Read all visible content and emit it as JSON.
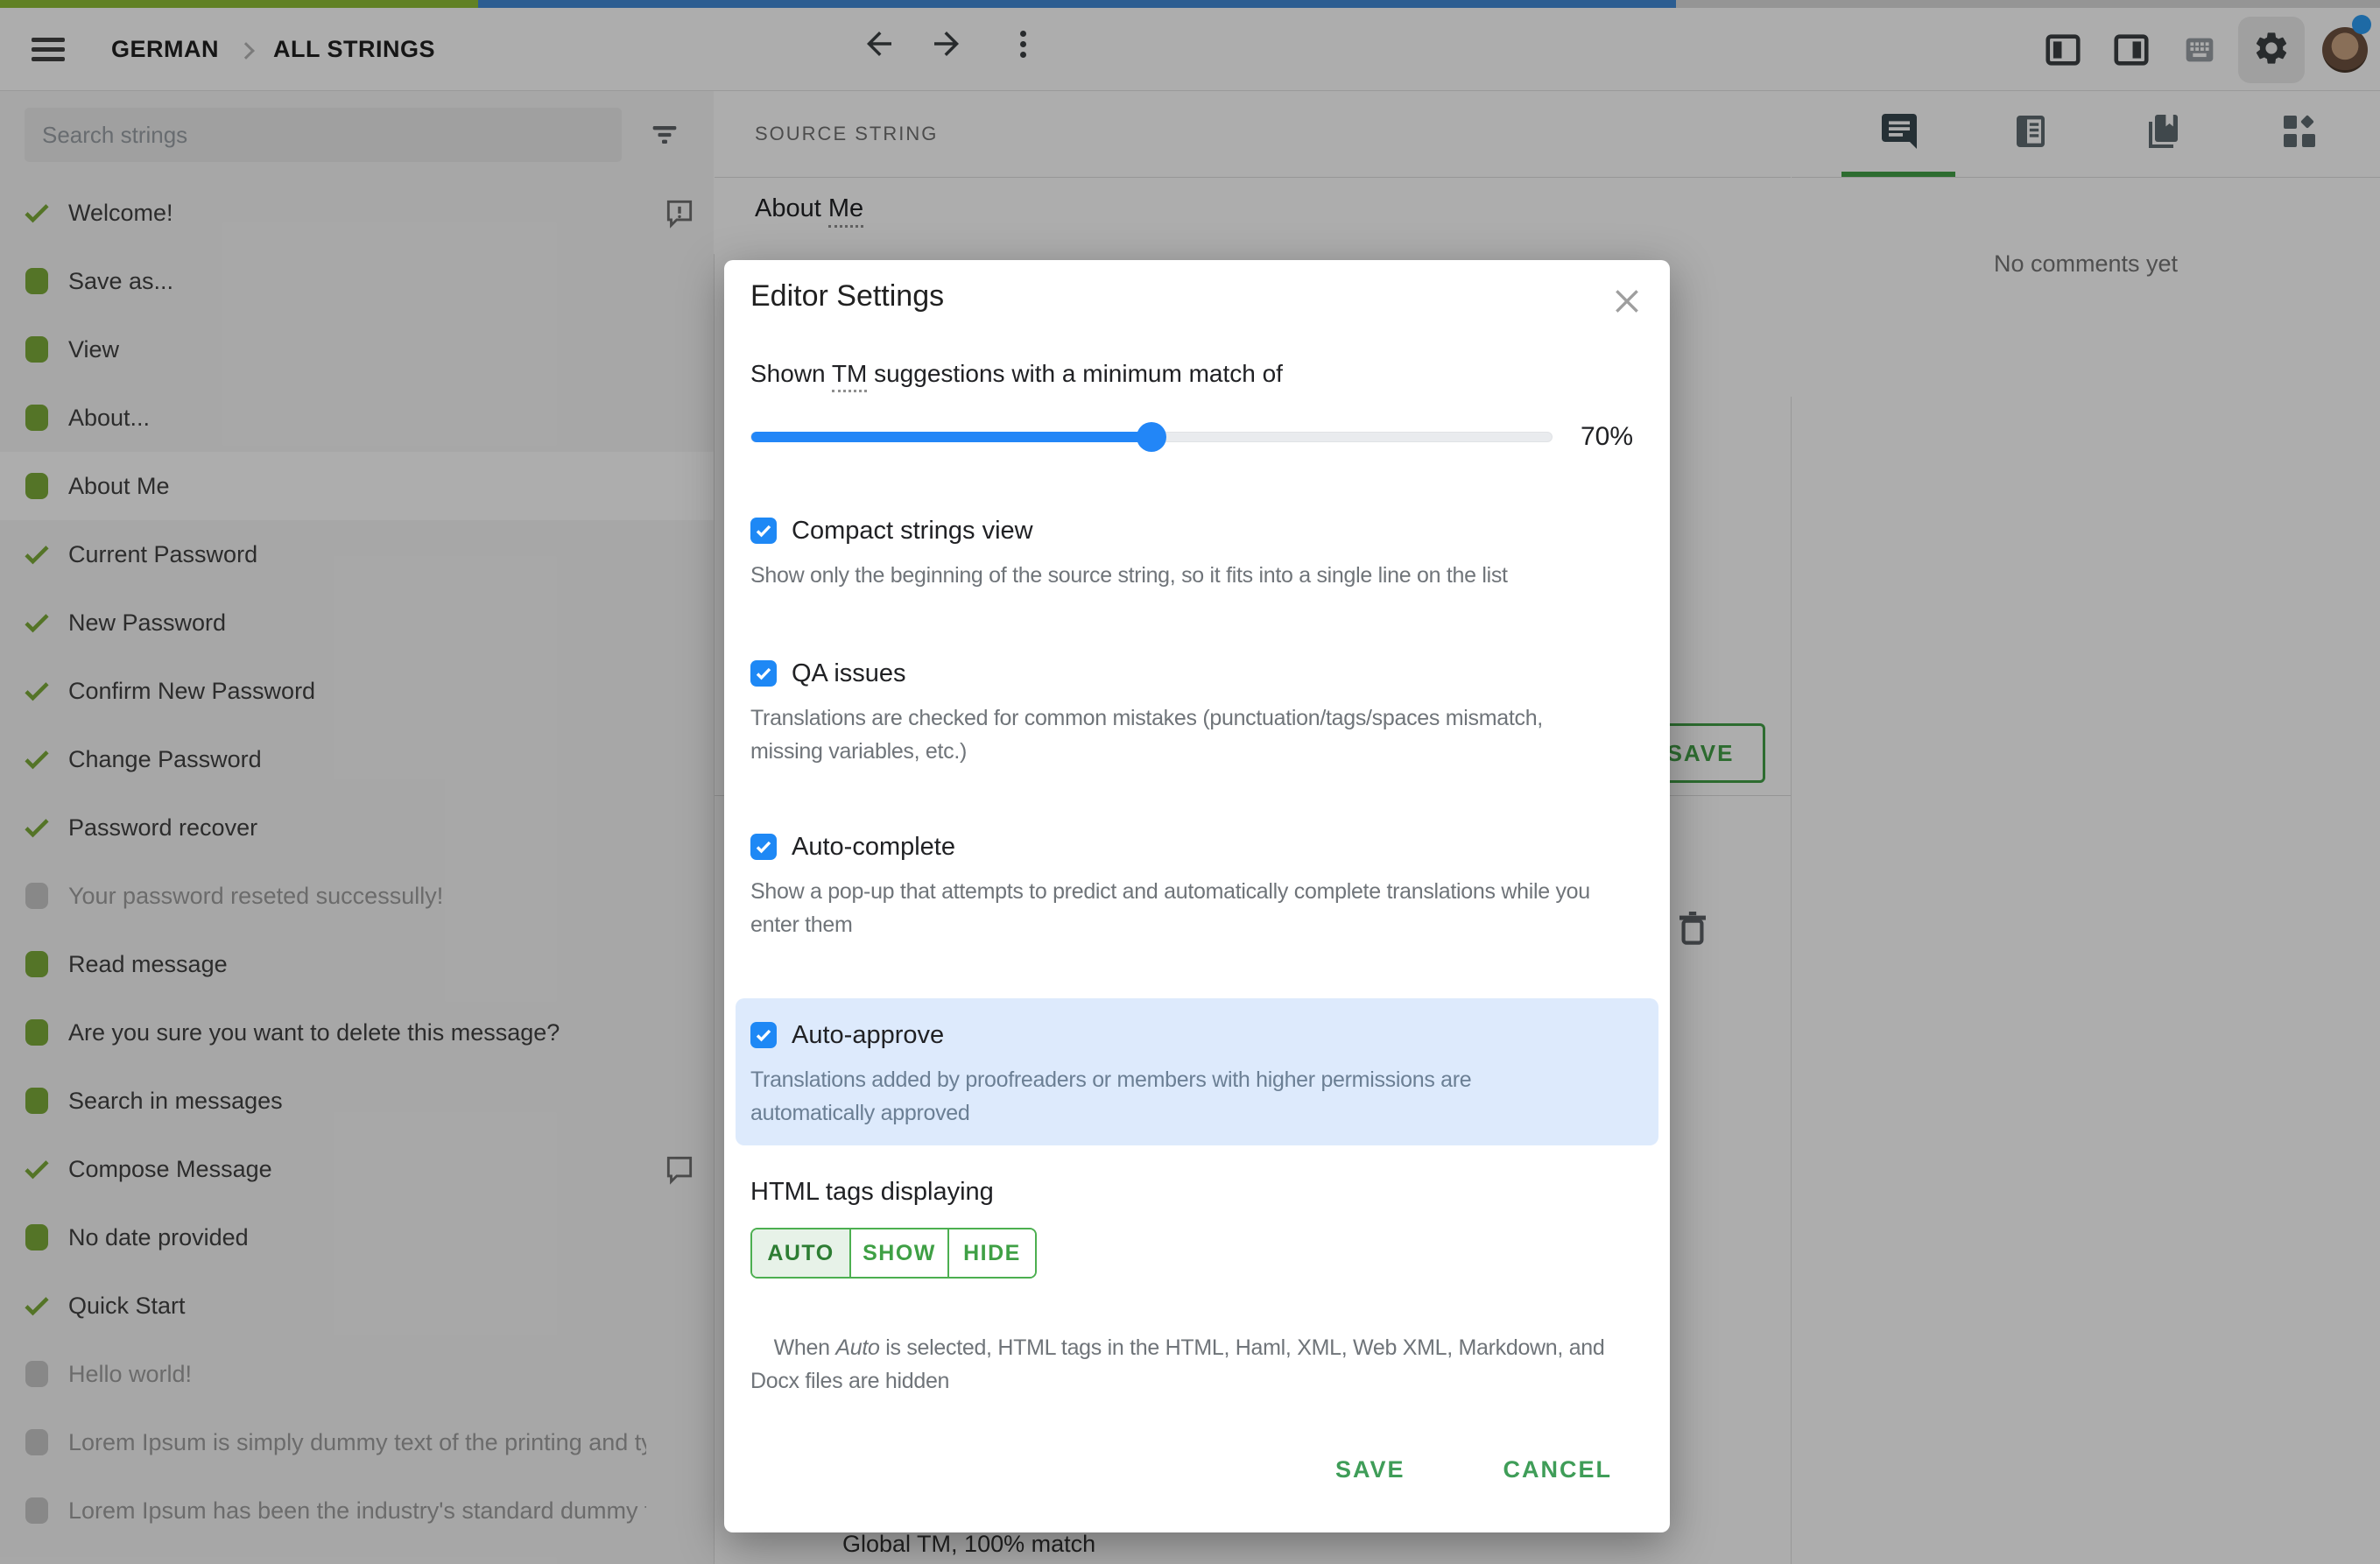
{
  "topbar": {
    "breadcrumb": {
      "project": "GERMAN",
      "section": "ALL STRINGS"
    },
    "progress": {
      "approved_pct": 20,
      "translated_pct": 50,
      "approved_color": "#8fbf35",
      "translated_color": "#4189d6"
    }
  },
  "sidebar": {
    "search_placeholder": "Search strings",
    "items": [
      {
        "label": "Welcome!",
        "status": "approved",
        "comment": "exclamation"
      },
      {
        "label": "Save as...",
        "status": "translated"
      },
      {
        "label": "View",
        "status": "translated"
      },
      {
        "label": "About...",
        "status": "translated"
      },
      {
        "label": "About Me",
        "status": "translated",
        "selected": true
      },
      {
        "label": "Current Password",
        "status": "approved"
      },
      {
        "label": "New Password",
        "status": "approved"
      },
      {
        "label": "Confirm New Password",
        "status": "approved"
      },
      {
        "label": "Change Password",
        "status": "approved"
      },
      {
        "label": "Password recover",
        "status": "approved"
      },
      {
        "label": "Your password reseted successully!",
        "status": "untranslated"
      },
      {
        "label": "Read message",
        "status": "translated"
      },
      {
        "label": "Are you sure you want to delete this message?",
        "status": "translated"
      },
      {
        "label": "Search in messages",
        "status": "translated"
      },
      {
        "label": "Compose Message",
        "status": "approved",
        "comment": "plain"
      },
      {
        "label": "No date provided",
        "status": "translated"
      },
      {
        "label": "Quick Start",
        "status": "approved"
      },
      {
        "label": "Hello world!",
        "status": "untranslated"
      },
      {
        "label": "Lorem Ipsum is simply dummy text of the printing and ty...",
        "status": "untranslated"
      },
      {
        "label": "Lorem Ipsum has been the industry's standard dummy t...",
        "status": "untranslated"
      }
    ]
  },
  "source_panel": {
    "header_label": "SOURCE STRING",
    "source_prefix": "About ",
    "source_term": "Me",
    "save_button_label": "SAVE",
    "suggestion_snippet": "Global TM, 100% match"
  },
  "comments_panel": {
    "empty_message": "No comments yet"
  },
  "modal": {
    "title": "Editor Settings",
    "tm_setting": {
      "label_prefix": "Shown ",
      "label_term": "TM",
      "label_suffix": " suggestions with a minimum match of",
      "value": 70,
      "value_label": "70%",
      "slider_fill_pct": 50
    },
    "options": [
      {
        "label": "Compact strings view",
        "checked": true,
        "description": "Show only the beginning of the source string, so it fits into a single line on the list"
      },
      {
        "label": "QA issues",
        "checked": true,
        "description": "Translations are checked for common mistakes (punctuation/tags/spaces mismatch,\nmissing variables, etc.)"
      },
      {
        "label": "Auto-complete",
        "checked": true,
        "description": "Show a pop-up that attempts to predict and automatically complete translations while you\nenter them"
      },
      {
        "label": "Auto-approve",
        "checked": true,
        "highlighted": true,
        "description": "Translations added by proofreaders or members with higher permissions are\nautomatically approved"
      }
    ],
    "html_tags": {
      "heading": "HTML tags displaying",
      "options": [
        {
          "label": "AUTO",
          "selected": true
        },
        {
          "label": "SHOW",
          "selected": false
        },
        {
          "label": "HIDE",
          "selected": false
        }
      ],
      "description_prefix": "When ",
      "description_italic": "Auto",
      "description_suffix": " is selected, HTML tags in the HTML, Haml, XML, Web XML, Markdown, and\nDocx files are hidden"
    },
    "footer": {
      "save_label": "SAVE",
      "cancel_label": "CANCEL"
    },
    "colors": {
      "checkbox_blue": "#1e88f5",
      "slider_blue": "#2286f7",
      "highlight_blue": "#ddeafc",
      "action_green": "#3f9d58",
      "segment_green": "#4caf50"
    }
  }
}
